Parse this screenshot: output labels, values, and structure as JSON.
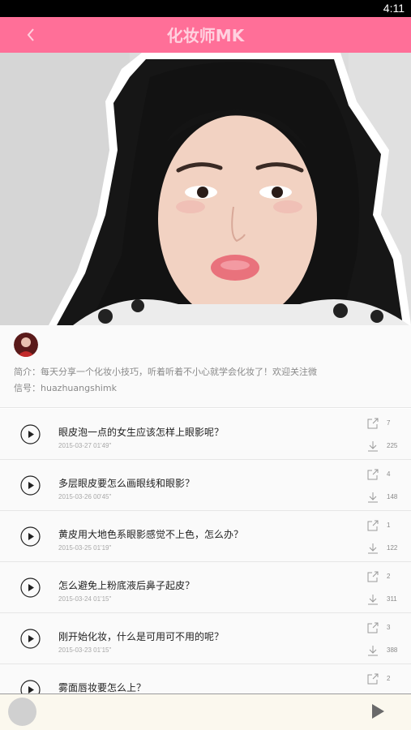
{
  "status": {
    "time": "4:11"
  },
  "header": {
    "title": "化妆师MK",
    "back_icon": "chevron-left-icon",
    "bg_color": "#ff6f98"
  },
  "profile": {
    "intro": "简介：每天分享一个化妆小技巧，听着听着不小心就学会化妆了！欢迎关注微信号：huazhuangshimk"
  },
  "episodes": [
    {
      "title": "眼皮泡一点的女生应该怎样上眼影呢？",
      "meta": "2015-03-27  01'49\"",
      "shares": "7",
      "downloads": "225"
    },
    {
      "title": "多层眼皮要怎么画眼线和眼影？",
      "meta": "2015-03-26  00'45\"",
      "shares": "4",
      "downloads": "148"
    },
    {
      "title": "黄皮用大地色系眼影感觉不上色，怎么办？",
      "meta": "2015-03-25  01'19\"",
      "shares": "1",
      "downloads": "122"
    },
    {
      "title": "怎么避免上粉底液后鼻子起皮？",
      "meta": "2015-03-24  01'15\"",
      "shares": "2",
      "downloads": "311"
    },
    {
      "title": "刚开始化妆，什么是可用可不用的呢？",
      "meta": "2015-03-23  01'15\"",
      "shares": "3",
      "downloads": "388"
    },
    {
      "title": "雾面唇妆要怎么上？",
      "meta": "",
      "shares": "2",
      "downloads": ""
    }
  ],
  "icons": {
    "play": "play-circle-icon",
    "share": "share-icon",
    "download": "download-icon",
    "player_play": "play-icon"
  }
}
